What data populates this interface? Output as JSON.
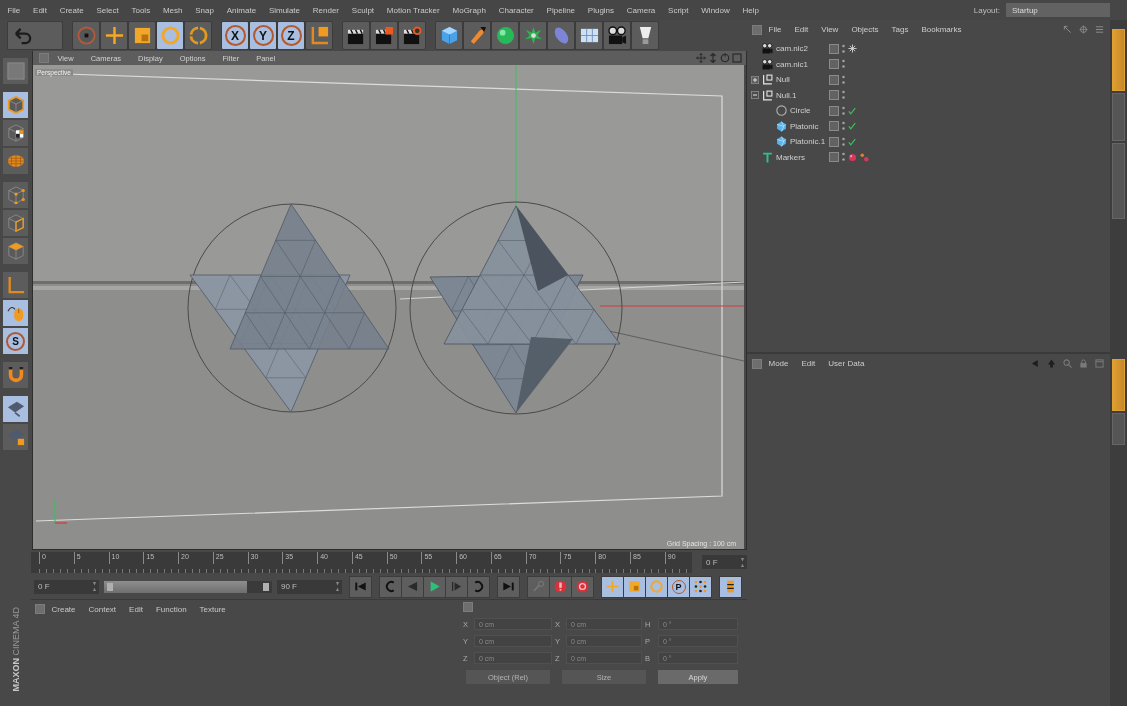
{
  "menu_bar": {
    "items": [
      "File",
      "Edit",
      "Create",
      "Select",
      "Tools",
      "Mesh",
      "Snap",
      "Animate",
      "Simulate",
      "Render",
      "Sculpt",
      "Motion Tracker",
      "MoGraph",
      "Character",
      "Pipeline",
      "Plugins",
      "Camera",
      "Script",
      "Window",
      "Help"
    ],
    "layout_label": "Layout:",
    "layout_value": "Startup"
  },
  "toolbar": {
    "groups": [
      {
        "buttons": [
          {
            "kind": "undo",
            "active": false
          }
        ]
      },
      {
        "buttons": [
          {
            "kind": "select",
            "active": false
          },
          {
            "kind": "move",
            "active": false
          },
          {
            "kind": "scale",
            "active": false
          },
          {
            "kind": "rotate",
            "active": true
          },
          {
            "kind": "recent",
            "active": false
          }
        ]
      },
      {
        "buttons": [
          {
            "kind": "lock-axis",
            "label": "X",
            "active": true
          },
          {
            "kind": "lock-axis",
            "label": "Y",
            "active": true
          },
          {
            "kind": "lock-axis",
            "label": "Z",
            "active": true
          },
          {
            "kind": "coord",
            "active": false
          }
        ]
      },
      {
        "buttons": [
          {
            "kind": "render-view",
            "active": false
          },
          {
            "kind": "render-picture",
            "active": false
          },
          {
            "kind": "render-settings",
            "active": false
          }
        ]
      },
      {
        "buttons": [
          {
            "kind": "cube",
            "active": false
          },
          {
            "kind": "pen",
            "active": false
          },
          {
            "kind": "subdivide",
            "active": false
          },
          {
            "kind": "array",
            "active": false
          },
          {
            "kind": "deformer",
            "active": false
          },
          {
            "kind": "floor",
            "active": false
          },
          {
            "kind": "camera",
            "active": false
          },
          {
            "kind": "light",
            "active": false
          }
        ]
      }
    ]
  },
  "left_toolbar": {
    "groups": [
      {
        "buttons": [
          {
            "kind": "make-editable",
            "active": false
          }
        ]
      },
      {
        "buttons": [
          {
            "kind": "model",
            "active": true
          },
          {
            "kind": "texture",
            "active": false
          },
          {
            "kind": "texture-axis",
            "active": false
          }
        ]
      },
      {
        "buttons": [
          {
            "kind": "points",
            "active": false
          },
          {
            "kind": "edges",
            "active": false
          },
          {
            "kind": "polygons",
            "active": false
          }
        ]
      },
      {
        "buttons": [
          {
            "kind": "axis",
            "active": false
          },
          {
            "kind": "tweak",
            "active": true
          },
          {
            "kind": "solo",
            "label": "S",
            "active": true
          }
        ]
      },
      {
        "buttons": [
          {
            "kind": "snap",
            "active": false
          }
        ]
      },
      {
        "buttons": [
          {
            "kind": "workplane",
            "active": true
          },
          {
            "kind": "workplane-lock",
            "active": false
          }
        ]
      }
    ]
  },
  "logo": {
    "brand": "MAXON",
    "product": "CINEMA 4D"
  },
  "viewport": {
    "menu": [
      "View",
      "Cameras",
      "Display",
      "Options",
      "Filter",
      "Panel"
    ],
    "camera_label": "Perspective",
    "grid_spacing": "Grid Spacing : 100 cm"
  },
  "timeline": {
    "ticks": [
      "0",
      "5",
      "10",
      "15",
      "20",
      "25",
      "30",
      "35",
      "40",
      "45",
      "50",
      "55",
      "60",
      "65",
      "70",
      "75",
      "80",
      "85",
      "90"
    ],
    "current_frame": "0 F",
    "start_field": "0 F",
    "range_slider": {
      "level": 0.85
    },
    "end_field": "90 F",
    "button_groups": [
      {
        "buttons": [
          {
            "kind": "go-start",
            "active": false
          }
        ]
      },
      {
        "buttons": [
          {
            "kind": "prev-key",
            "active": false
          },
          {
            "kind": "prev-frame",
            "active": false
          },
          {
            "kind": "play",
            "active": false
          },
          {
            "kind": "next-frame",
            "active": false
          },
          {
            "kind": "next-key",
            "active": false
          }
        ]
      },
      {
        "buttons": [
          {
            "kind": "go-end",
            "active": false
          }
        ]
      },
      {
        "buttons": [
          {
            "kind": "key",
            "active": false
          },
          {
            "kind": "record",
            "active": false
          },
          {
            "kind": "autokey",
            "active": false
          }
        ]
      },
      {
        "buttons": [
          {
            "kind": "key-move",
            "active": true
          },
          {
            "kind": "key-scale",
            "active": true
          },
          {
            "kind": "key-rotate",
            "active": true
          },
          {
            "kind": "key-param",
            "label": "P",
            "active": true
          },
          {
            "kind": "key-pla",
            "active": true
          }
        ]
      },
      {
        "buttons": [
          {
            "kind": "scheme",
            "active": true
          }
        ]
      }
    ]
  },
  "material_manager": {
    "menu": [
      "Create",
      "Context",
      "Edit",
      "Function",
      "Texture"
    ]
  },
  "coordinates": {
    "rows": [
      {
        "position_label": "X",
        "position_value": "0 cm",
        "size_label": "X",
        "size_value": "0 cm",
        "rotation_label": "H",
        "rotation_value": "0 °"
      },
      {
        "position_label": "Y",
        "position_value": "0 cm",
        "size_label": "Y",
        "size_value": "0 cm",
        "rotation_label": "P",
        "rotation_value": "0 °"
      },
      {
        "position_label": "Z",
        "position_value": "0 cm",
        "size_label": "Z",
        "size_value": "0 cm",
        "rotation_label": "B",
        "rotation_value": "0 °"
      }
    ],
    "mode": "Object (Rel)",
    "size_mode": "Size",
    "apply": "Apply"
  },
  "object_manager": {
    "menu": [
      "File",
      "Edit",
      "View",
      "Objects",
      "Tags",
      "Bookmarks"
    ],
    "objects": [
      {
        "name": "cam.nlc2",
        "kind": "camera",
        "check": false,
        "tags": [
          {
            "kind": "asterisk"
          }
        ]
      },
      {
        "name": "cam.nlc1",
        "kind": "camera",
        "check": false
      },
      {
        "name": "Null",
        "kind": "null",
        "check": false,
        "expanded": false
      },
      {
        "name": "Null.1",
        "kind": "null",
        "check": false,
        "expanded": true,
        "children": [
          {
            "name": "Circle",
            "kind": "circle",
            "check": true
          },
          {
            "name": "Platonic",
            "kind": "platonic",
            "check": true
          },
          {
            "name": "Platonic.1",
            "kind": "platonic",
            "check": true
          }
        ]
      },
      {
        "name": "Markers",
        "kind": "text",
        "check": false,
        "tags": [
          {
            "kind": "ball"
          },
          {
            "kind": "dots"
          }
        ]
      }
    ]
  },
  "attribute_manager": {
    "menu": [
      "Mode",
      "Edit",
      "User Data"
    ]
  },
  "side_tabs": {
    "upper": [
      {
        "selected": true
      },
      {
        "selected": false
      },
      {
        "selected": false
      }
    ],
    "lower": [
      {
        "selected": true
      },
      {
        "selected": false
      }
    ]
  }
}
